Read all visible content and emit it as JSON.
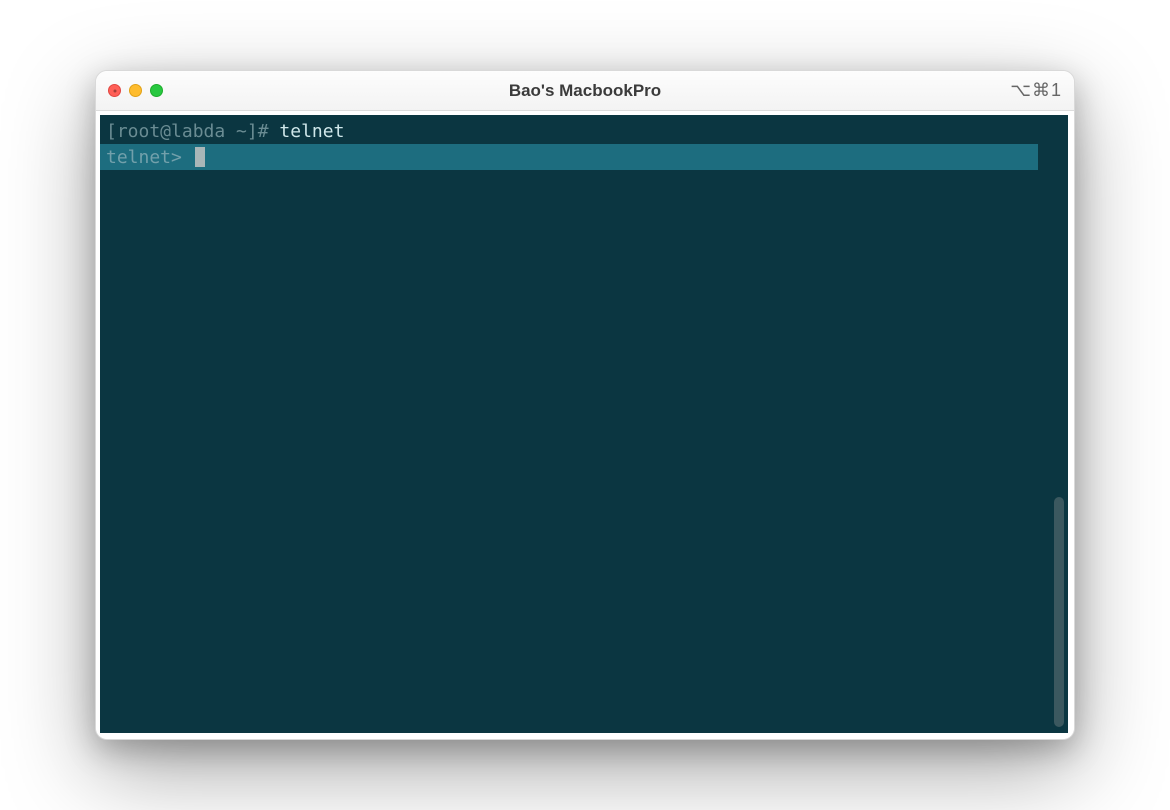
{
  "window": {
    "title": "Bao's MacbookPro",
    "shortcut": "⌥⌘1"
  },
  "terminal": {
    "line1_prompt": "[root@labda ~]# ",
    "line1_command": "telnet",
    "line2_prompt": "telnet> "
  },
  "colors": {
    "terminal_bg": "#0b3641",
    "highlight_bg": "#1d6d7f",
    "prompt_fg": "#6a8c93"
  }
}
